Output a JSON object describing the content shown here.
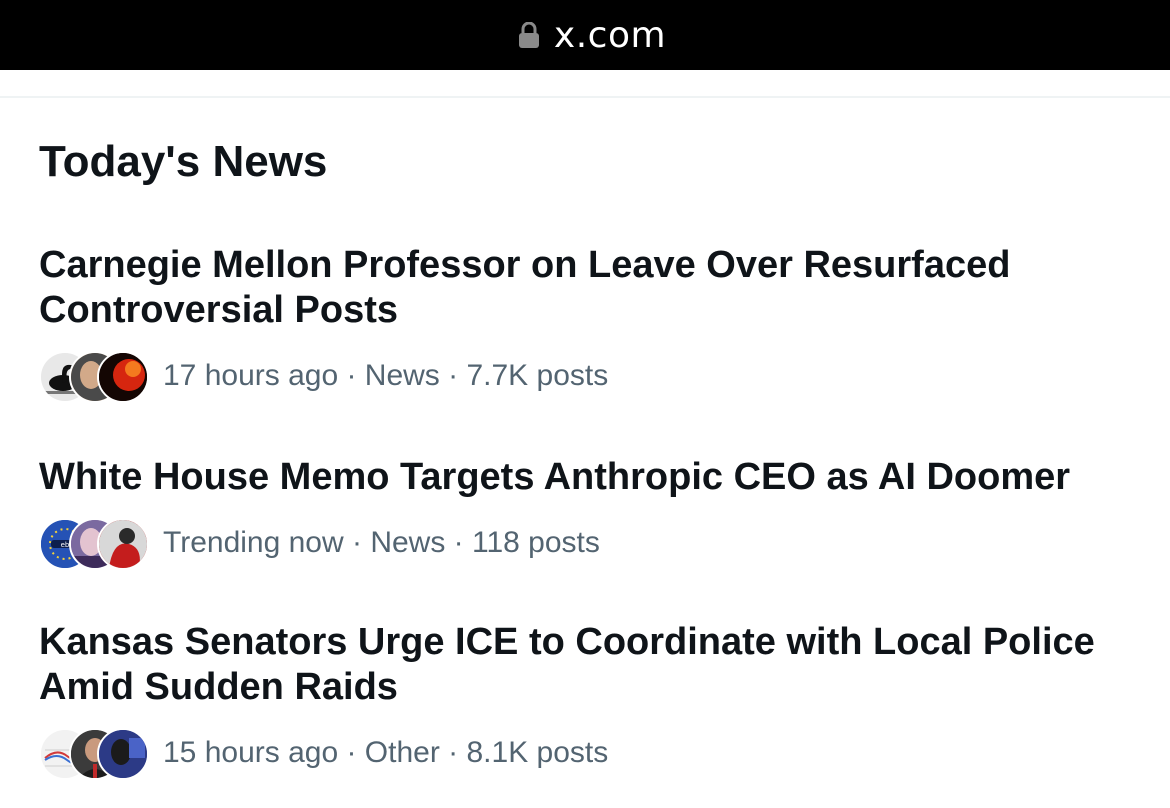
{
  "browser": {
    "url": "x.com",
    "lock_icon": "lock-icon"
  },
  "section": {
    "title": "Today's News"
  },
  "news": [
    {
      "headline": "Carnegie Mellon Professor on Leave Over Resurfaced Controversial Posts",
      "meta": "17 hours ago · News · 7.7K posts",
      "avatars": [
        "avatar-bird-silhouette",
        "avatar-person",
        "avatar-red-flame"
      ]
    },
    {
      "headline": "White House Memo Targets Anthropic CEO as AI Doomer",
      "meta": "Trending now · News · 118 posts",
      "avatars": [
        "avatar-eu-stars-logo",
        "avatar-person-purple",
        "avatar-person-red"
      ]
    },
    {
      "headline": "Kansas Senators Urge ICE to Coordinate with Local Police Amid Sudden Raids",
      "meta": "15 hours ago · Other · 8.1K posts",
      "avatars": [
        "avatar-chart-lines",
        "avatar-person-suit",
        "avatar-person-blue"
      ]
    }
  ],
  "colors": {
    "text_primary": "#0f1419",
    "text_secondary": "#536471",
    "bar": "#000000"
  }
}
